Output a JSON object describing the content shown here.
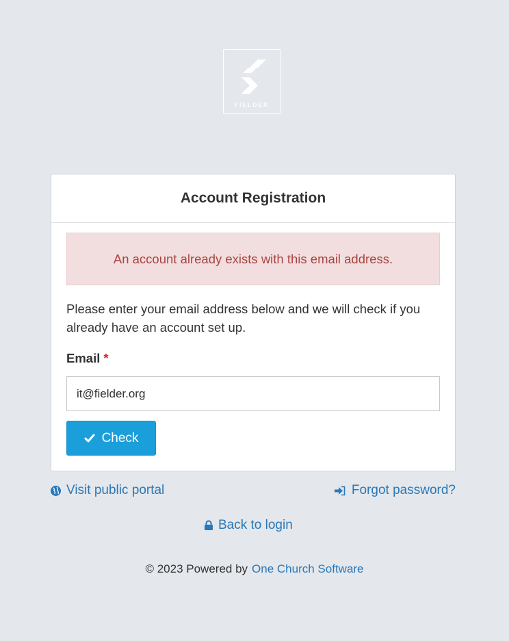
{
  "logo": {
    "text": "FIELDER"
  },
  "card": {
    "title": "Account Registration",
    "alert": "An account already exists with this email address.",
    "intro": "Please enter your email address below and we will check if you already have an account set up.",
    "email_label": "Email",
    "required_marker": "*",
    "email_value": "it@fielder.org",
    "check_label": "Check"
  },
  "links": {
    "portal": "Visit public portal",
    "forgot": "Forgot password?",
    "back": "Back to login"
  },
  "footer": {
    "prefix": "© 2023 Powered by",
    "vendor": "One Church Software"
  },
  "icons": {
    "logo": "chevrons-logo",
    "check": "checkmark-icon",
    "portal": "globe-icon",
    "forgot": "sign-in-arrow-icon",
    "back": "lock-icon"
  },
  "colors": {
    "background": "#e4e7eb",
    "primary_button": "#1b9fda",
    "alert_bg": "#f2dede",
    "alert_text": "#a94442",
    "link": "#2a78b8",
    "required": "#d9242a"
  }
}
